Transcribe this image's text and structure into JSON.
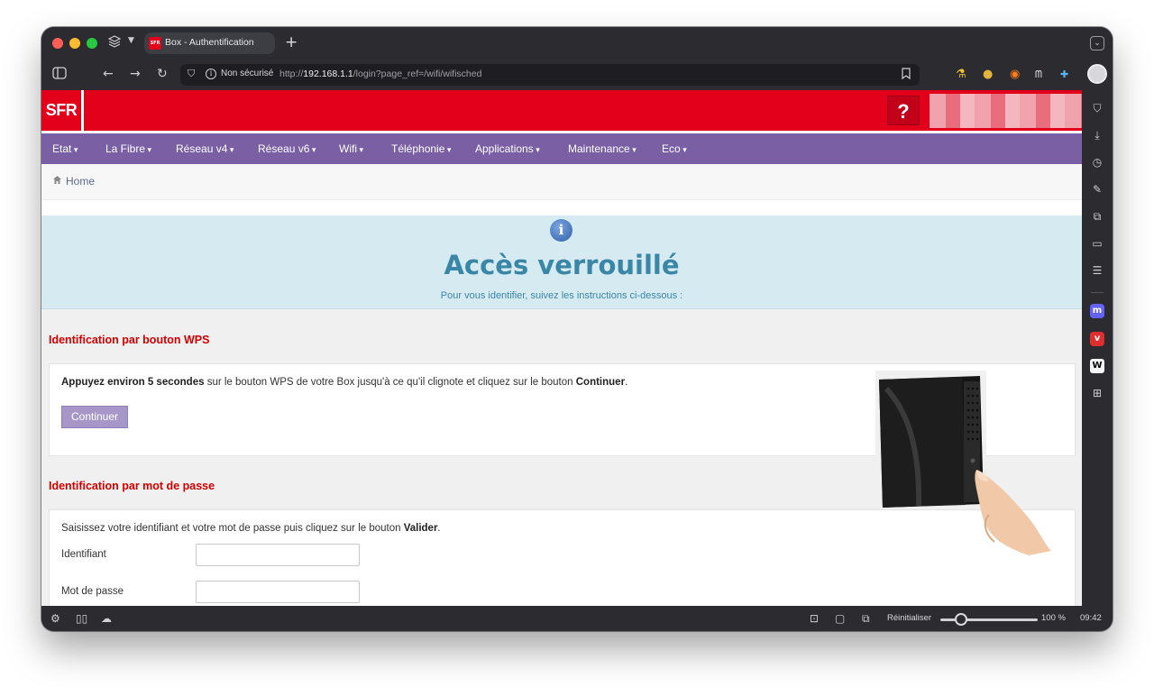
{
  "browser": {
    "tab_title": "Box - Authentification",
    "tab_favicon_text": "SFR",
    "new_tab": "+",
    "security_label": "Non sécurisé",
    "url_prefix": "http://",
    "url_host": "192.168.1.1",
    "url_path": "/login?page_ref=/wifi/wifisched",
    "status_reset_label": "Réinitialiser",
    "zoom_level": "100 %",
    "clock": "09:42"
  },
  "header": {
    "logo": "SFR",
    "help": "?"
  },
  "nav": {
    "items": [
      "Etat",
      "La Fibre",
      "Réseau v4",
      "Réseau v6",
      "Wifi",
      "Téléphonie",
      "Applications",
      "Maintenance",
      "Eco"
    ]
  },
  "breadcrumb": {
    "home": "Home"
  },
  "banner": {
    "title": "Accès verrouillé",
    "subtitle": "Pour vous identifier, suivez les instructions ci-dessous :"
  },
  "wps": {
    "title": "Identification par bouton WPS",
    "text_bold_1": "Appuyez environ 5 secondes",
    "text_1": " sur le bouton WPS de votre Box jusqu'à ce qu'il clignote et cliquez sur le bouton ",
    "text_bold_2": "Continuer",
    "text_2": ".",
    "button": "Continuer"
  },
  "password": {
    "title": "Identification par mot de passe",
    "text_1": "Saisissez votre identifiant et votre mot de passe puis cliquez sur le bouton ",
    "text_bold": "Valider",
    "text_2": ".",
    "login_label": "Identifiant",
    "login_value": "",
    "password_label": "Mot de passe",
    "password_value": ""
  },
  "colors": {
    "sfr_red": "#e2001a",
    "nav_purple": "#7a5fa5",
    "banner_blue": "#d6eaf2",
    "title_blue": "#3a86a6",
    "section_red": "#d40000"
  }
}
